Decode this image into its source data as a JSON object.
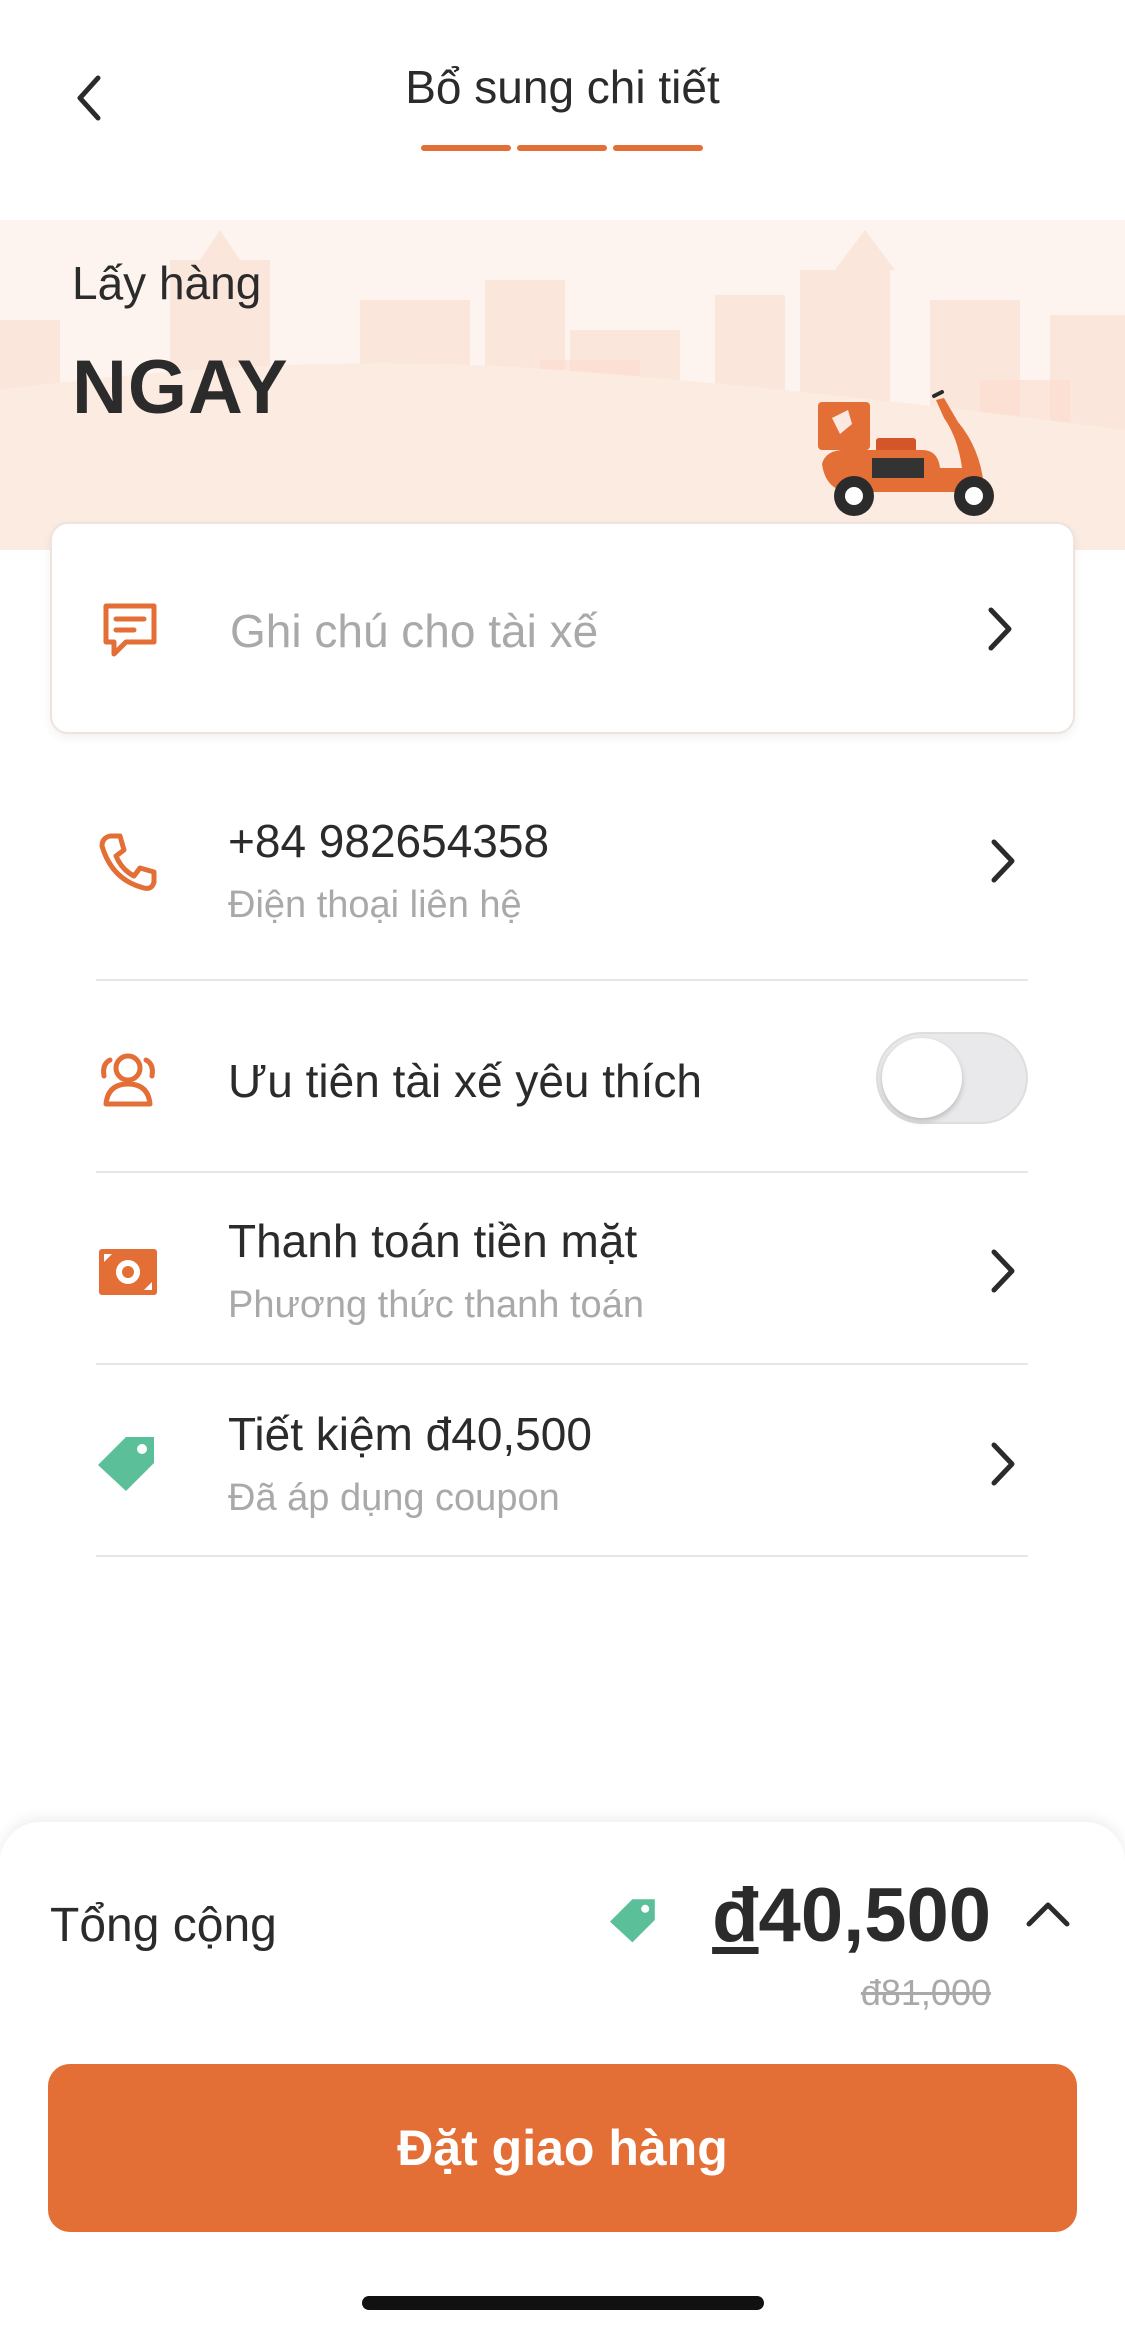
{
  "header": {
    "title": "Bổ sung chi tiết",
    "back_icon": "chevron-left-icon",
    "steps_total": 3,
    "steps_completed": 3
  },
  "hero": {
    "label": "Lấy hàng",
    "value": "NGAY",
    "illustration": "delivery-scooter"
  },
  "note": {
    "placeholder": "Ghi chú cho tài xế",
    "icon": "message-icon"
  },
  "rows": {
    "phone": {
      "main": "+84 982654358",
      "sub": "Điện thoại liên hệ",
      "icon": "phone-icon"
    },
    "favorite": {
      "main": "Ưu tiên tài xế yêu thích",
      "icon": "driver-group-icon",
      "toggle_on": false
    },
    "payment": {
      "main": "Thanh toán tiền mặt",
      "sub": "Phương thức thanh toán",
      "icon": "cash-icon"
    },
    "coupon": {
      "main": "Tiết kiệm đ40,500",
      "sub": "Đã áp dụng coupon",
      "icon": "tag-icon"
    }
  },
  "summary": {
    "label": "Tổng cộng",
    "currency": "đ",
    "price": "40,500",
    "old_price": "đ81,000"
  },
  "cta": {
    "label": "Đặt giao hàng"
  },
  "colors": {
    "accent": "#e36e36",
    "coupon": "#5bbf9a",
    "hero_bg": "#fdf4ef",
    "muted_text": "#a9a9a9"
  }
}
